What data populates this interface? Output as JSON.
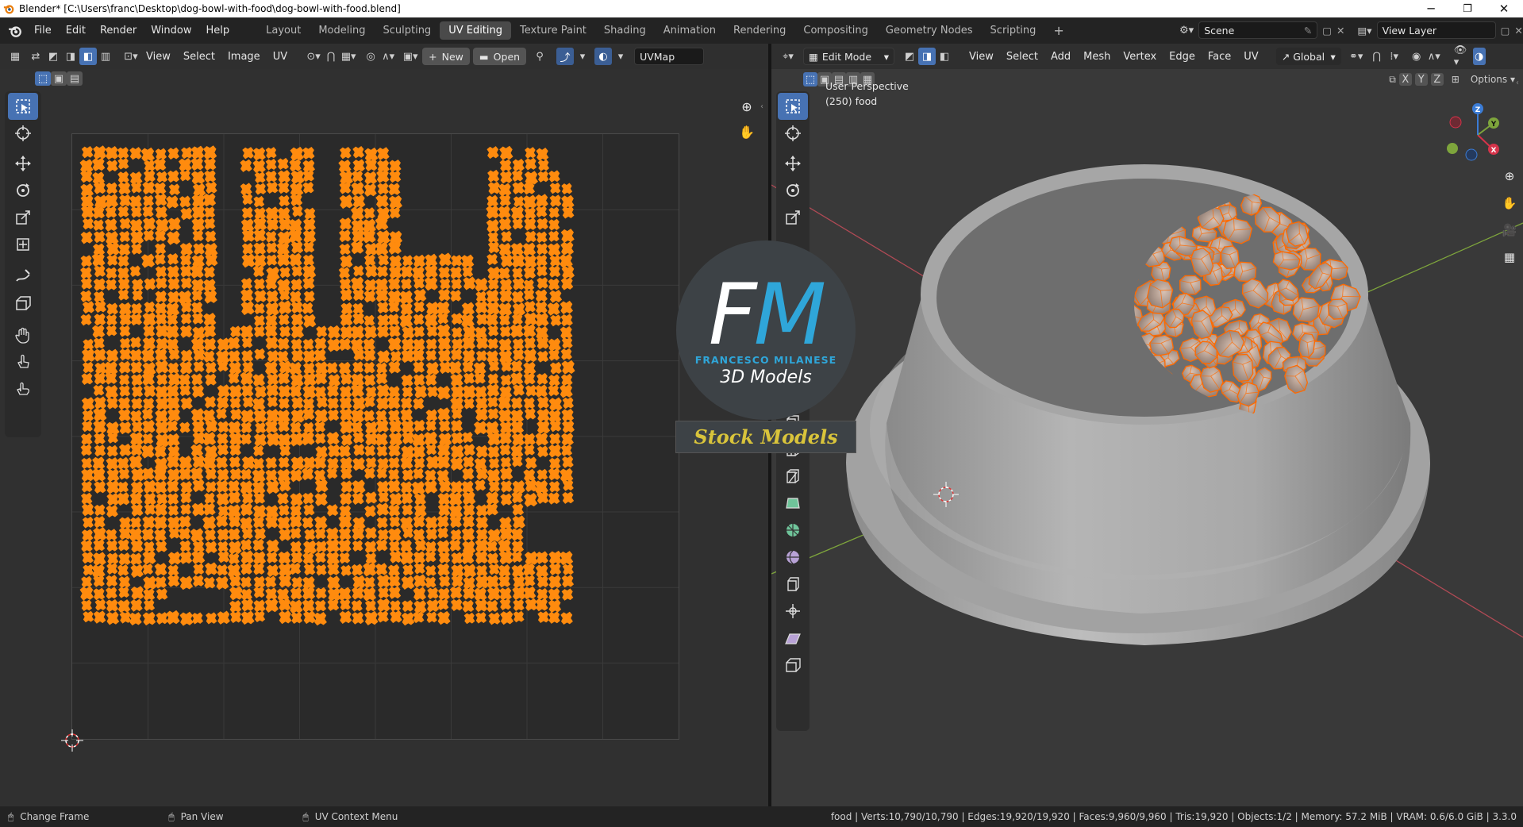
{
  "window": {
    "title": "Blender* [C:\\Users\\franc\\Desktop\\dog-bowl-with-food\\dog-bowl-with-food.blend]",
    "controls": {
      "minimize": "─",
      "restore": "❐",
      "close": "✕"
    }
  },
  "menus": [
    "File",
    "Edit",
    "Render",
    "Window",
    "Help"
  ],
  "workspaces": [
    "Layout",
    "Modeling",
    "Sculpting",
    "UV Editing",
    "Texture Paint",
    "Shading",
    "Animation",
    "Rendering",
    "Compositing",
    "Geometry Nodes",
    "Scripting"
  ],
  "active_workspace": "UV Editing",
  "add_workspace": "+",
  "scene": {
    "label": "Scene",
    "view_layer": "View Layer"
  },
  "uv_editor": {
    "menus": [
      "View",
      "Select",
      "Image",
      "UV"
    ],
    "new_label": "New",
    "open_label": "Open",
    "uvmap": "UVMap",
    "island_color": "#ff8b0e"
  },
  "viewport": {
    "mode": "Edit Mode",
    "menus": [
      "View",
      "Select",
      "Add",
      "Mesh",
      "Vertex",
      "Edge",
      "Face",
      "UV"
    ],
    "transform_orientation": "Global",
    "axes": {
      "x": "X",
      "y": "Y",
      "z": "Z"
    },
    "options_label": "Options",
    "overlay_line1": "User Perspective",
    "overlay_line2": "(250) food"
  },
  "watermark": {
    "letters_f": "F",
    "letters_m": "M",
    "brand": "FRANCESCO MILANESE",
    "subtitle": "3D Models",
    "banner": "Stock Models"
  },
  "status": {
    "left": "Change Frame",
    "middle": "Pan View",
    "right": "UV Context Menu",
    "stats": "food | Verts:10,790/10,790 | Edges:19,920/19,920 | Faces:9,960/9,960 | Tris:19,920 | Objects:1/2 | Memory: 57.2 MiB | VRAM: 0.6/6.0 GiB | 3.3.0"
  },
  "colors": {
    "accent": "#4772b3",
    "uv_island": "#ff8b0e",
    "edge_select": "#ff6a00",
    "x_axis": "#d6334a",
    "y_axis": "#7ea53c",
    "z_axis": "#3b7cd6"
  }
}
